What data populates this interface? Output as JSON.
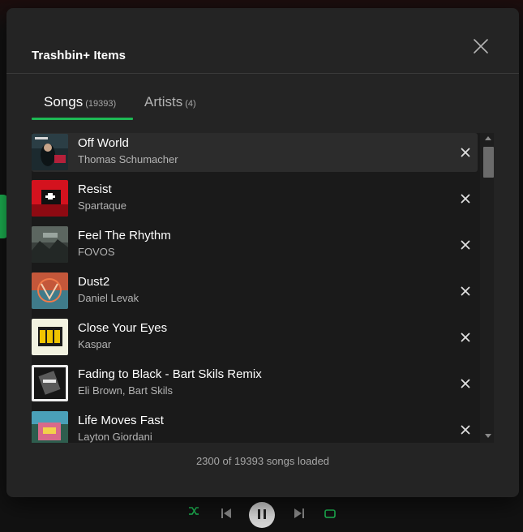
{
  "modal": {
    "title": "Trashbin+ Items",
    "tabs": [
      {
        "label": "Songs",
        "count": "(19393)"
      },
      {
        "label": "Artists",
        "count": "(4)"
      }
    ],
    "songs": [
      {
        "title": "Off World",
        "artist": "Thomas Schumacher"
      },
      {
        "title": "Resist",
        "artist": "Spartaque"
      },
      {
        "title": "Feel The Rhythm",
        "artist": "FOVOS"
      },
      {
        "title": "Dust2",
        "artist": "Daniel Levak"
      },
      {
        "title": "Close Your Eyes",
        "artist": "Kaspar"
      },
      {
        "title": "Fading to Black - Bart Skils Remix",
        "artist": "Eli Brown, Bart Skils"
      },
      {
        "title": "Life Moves Fast",
        "artist": "Layton Giordani"
      }
    ],
    "status": "2300 of 19393 songs loaded"
  },
  "colors": {
    "accent": "#1db954",
    "modal_bg": "#242424",
    "list_bg": "#1a1a1a",
    "highlight_row": "#2c2c2c"
  },
  "icons": [
    "close-icon",
    "remove-icon",
    "scroll-up-arrow",
    "scroll-down-arrow"
  ]
}
